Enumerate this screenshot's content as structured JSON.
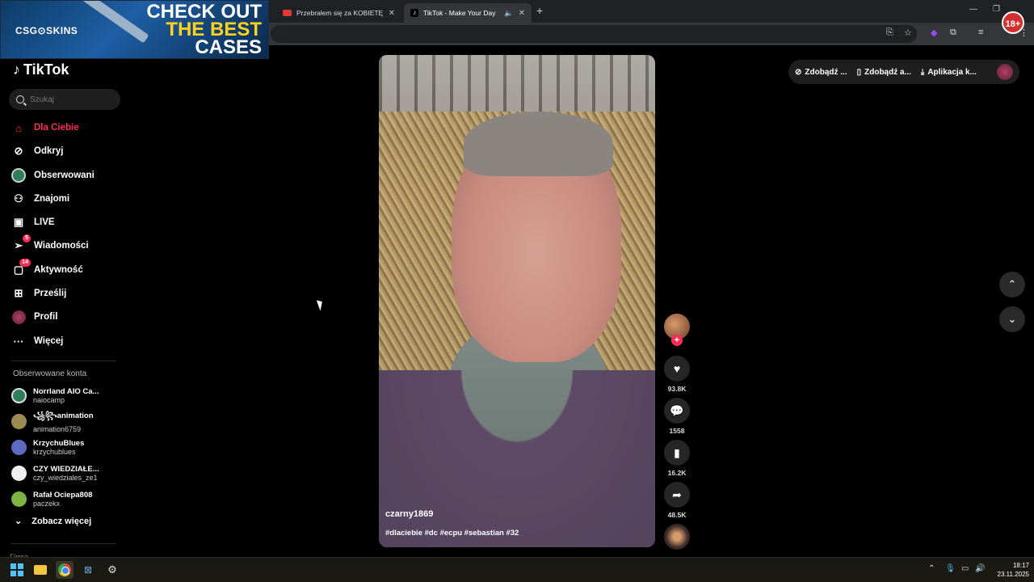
{
  "browser": {
    "tabs": [
      {
        "title": "Przebrałem się za KOBIETĘ na S",
        "active": false
      },
      {
        "title": "TikTok - Make Your Day",
        "active": true
      }
    ],
    "badge": "18+"
  },
  "ad": {
    "brand": "CSG⊙SKINS",
    "line1": "CHECK OUT",
    "line2": "THE BEST",
    "line3": "CASES"
  },
  "sidebar": {
    "logo": "TikTok",
    "search_placeholder": "Szukaj",
    "nav": [
      {
        "label": "Dla Ciebie",
        "icon": "home-icon",
        "active": true
      },
      {
        "label": "Odkryj",
        "icon": "compass-icon"
      },
      {
        "label": "Obserwowani",
        "icon": "following-avatar-icon"
      },
      {
        "label": "Znajomi",
        "icon": "friends-icon"
      },
      {
        "label": "LIVE",
        "icon": "live-icon"
      },
      {
        "label": "Wiadomości",
        "icon": "messages-icon",
        "badge": "5"
      },
      {
        "label": "Aktywność",
        "icon": "activity-icon",
        "badge": "14"
      },
      {
        "label": "Prześlij",
        "icon": "upload-icon"
      },
      {
        "label": "Profil",
        "icon": "profile-avatar-icon"
      },
      {
        "label": "Więcej",
        "icon": "more-dots-icon"
      }
    ],
    "section_title": "Obserwowane konta",
    "accounts": [
      {
        "name": "Norrland AIO Ca...",
        "handle": "naiocamp",
        "color": "#2e7d5b"
      },
      {
        "name": "꧁꧂animation",
        "handle": "animation6759",
        "color": "#9c8a52"
      },
      {
        "name": "KrzychuBlues",
        "handle": "krzychublues",
        "color": "#5c6bc0"
      },
      {
        "name": "CZY WIEDZIAŁE...",
        "handle": "czy_wiedziales_ze1",
        "color": "#eeeeee"
      },
      {
        "name": "Rafał Ociepa808",
        "handle": "paczekx",
        "color": "#7cb342"
      }
    ],
    "see_more": "Zobacz więcej",
    "footer": "Firma"
  },
  "top_pill": {
    "item1": "Zdobądź ...",
    "item2": "Zdobądź a...",
    "item3": "Aplikacja k..."
  },
  "video": {
    "author": "czarny1869",
    "tags": "#dlaciebie #dc #ecpu #sebastian #32"
  },
  "actions": {
    "likes": "93.8K",
    "comments": "1558",
    "saves": "16.2K",
    "shares": "48.5K"
  },
  "taskbar": {
    "time": "18:17",
    "date": "23.11.2025"
  }
}
